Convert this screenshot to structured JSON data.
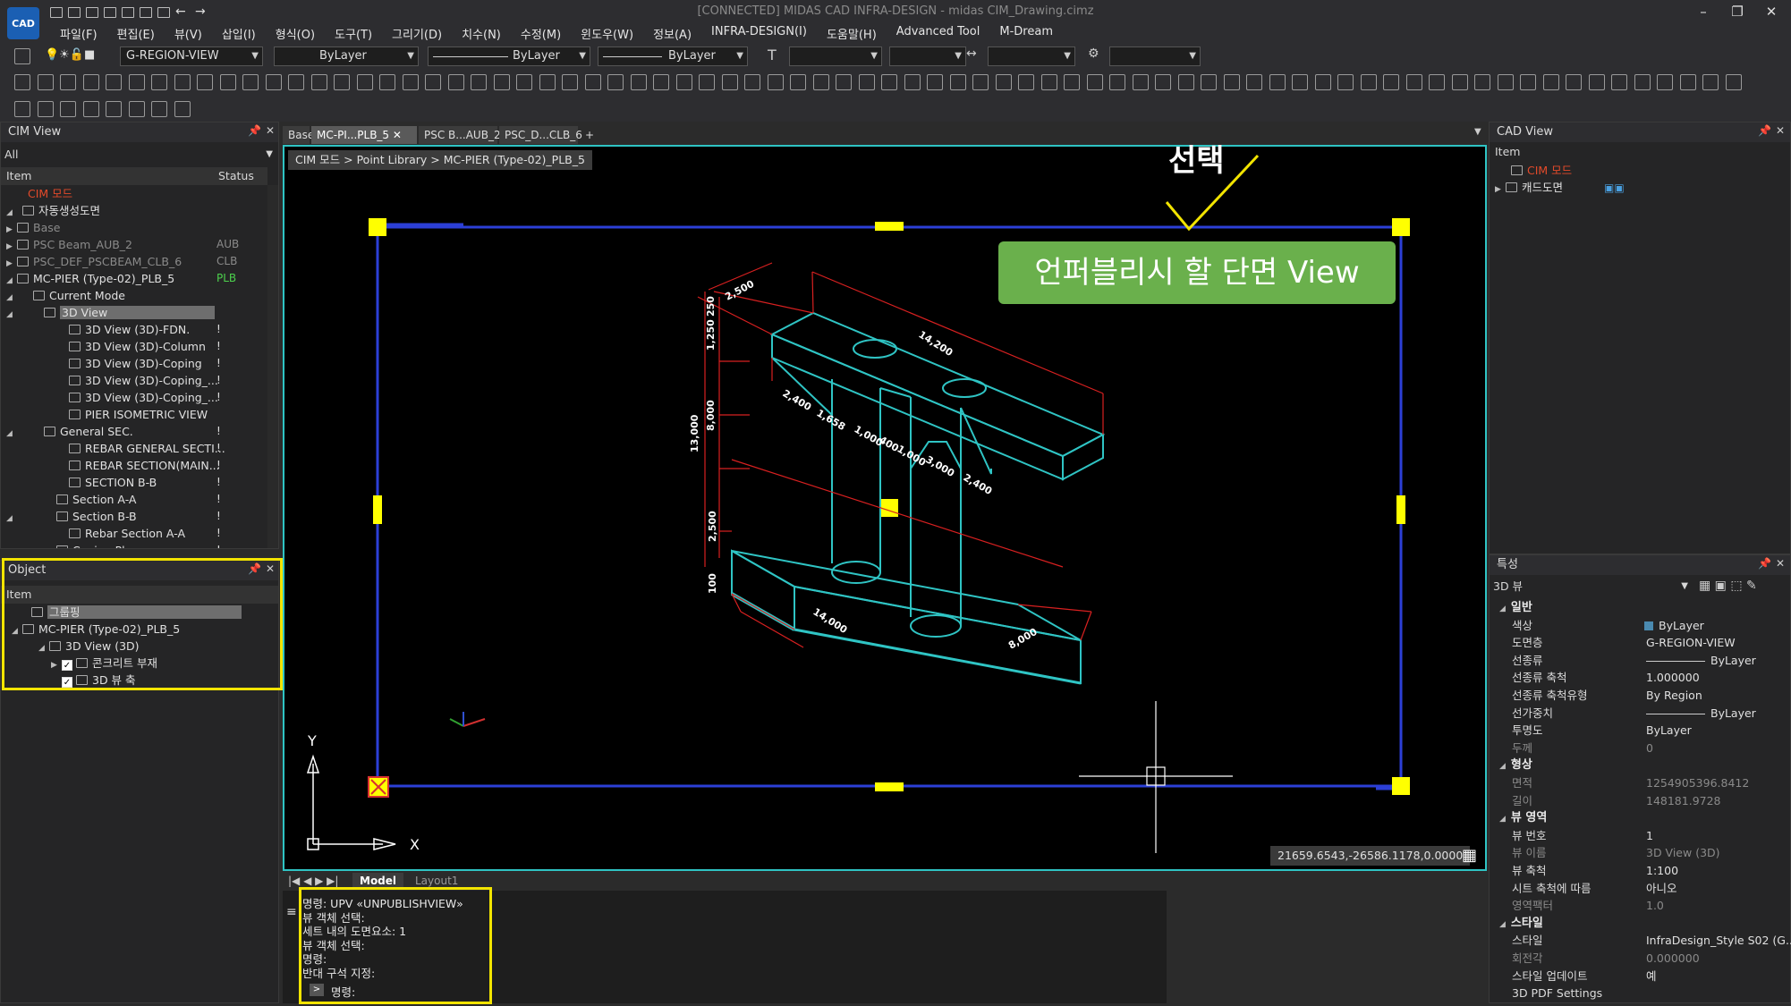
{
  "window": {
    "title": "[CONNECTED] MIDAS CAD INFRA-DESIGN - midas CIM_Drawing.cimz",
    "logo_text": "CAD",
    "buttons": [
      "–",
      "❐",
      "✕"
    ]
  },
  "menu": [
    "파일(F)",
    "편집(E)",
    "뷰(V)",
    "삽입(I)",
    "형식(O)",
    "도구(T)",
    "그리기(D)",
    "치수(N)",
    "수정(M)",
    "윈도우(W)",
    "정보(A)",
    "INFRA-DESIGN(I)",
    "도움말(H)",
    "Advanced Tool",
    "M-Dream"
  ],
  "toolbar": {
    "layer": "G-REGION-VIEW",
    "color": "ByLayer",
    "linetype": "ByLayer",
    "lineweight": "ByLayer",
    "color_swatch": "#4a8ab0"
  },
  "cim_view": {
    "title": "CIM View",
    "filter": "All",
    "col_item": "Item",
    "col_status": "Status",
    "rows": [
      {
        "label": "CIM 모드",
        "status": "",
        "color": "#e34a2a"
      },
      {
        "label": "자동생성도면",
        "status": "",
        "color": "#e0e0e0"
      },
      {
        "label": "Base",
        "status": "",
        "color": "#8a8a8a"
      },
      {
        "label": "PSC Beam_AUB_2",
        "status": "AUB",
        "color": "#8a8a8a"
      },
      {
        "label": "PSC_DEF_PSCBEAM_CLB_6",
        "status": "CLB",
        "color": "#8a8a8a"
      },
      {
        "label": "MC-PIER (Type-02)_PLB_5",
        "status": "PLB",
        "color": "#e0e0e0"
      },
      {
        "label": "Current Mode",
        "status": "",
        "color": "#e0e0e0"
      },
      {
        "label": "3D View",
        "status": "",
        "color": "#e0e0e0"
      },
      {
        "label": "3D View (3D)-FDN.",
        "status": "!",
        "color": "#e0e0e0"
      },
      {
        "label": "3D View (3D)-Column",
        "status": "!",
        "color": "#e0e0e0"
      },
      {
        "label": "3D View (3D)-Coping",
        "status": "!",
        "color": "#e0e0e0"
      },
      {
        "label": "3D View (3D)-Coping_...",
        "status": "!",
        "color": "#e0e0e0"
      },
      {
        "label": "3D View (3D)-Coping_...",
        "status": "!",
        "color": "#e0e0e0"
      },
      {
        "label": "PIER ISOMETRIC VIEW",
        "status": "",
        "color": "#e0e0e0"
      },
      {
        "label": "General SEC.",
        "status": "!",
        "color": "#e0e0e0"
      },
      {
        "label": "REBAR GENERAL SECTI...",
        "status": "!",
        "color": "#e0e0e0"
      },
      {
        "label": "REBAR SECTION(MAIN...",
        "status": "!",
        "color": "#e0e0e0"
      },
      {
        "label": "SECTION B-B",
        "status": "!",
        "color": "#e0e0e0"
      },
      {
        "label": "Section A-A",
        "status": "!",
        "color": "#e0e0e0"
      },
      {
        "label": "Section B-B",
        "status": "!",
        "color": "#e0e0e0"
      },
      {
        "label": "Rebar Section A-A",
        "status": "!",
        "color": "#e0e0e0"
      },
      {
        "label": "Coping Plan",
        "status": "!",
        "color": "#e0e0e0"
      }
    ]
  },
  "object_panel": {
    "title": "Object",
    "col_item": "Item",
    "rows": [
      "그룹핑",
      "MC-PIER (Type-02)_PLB_5",
      "3D View (3D)",
      "콘크리트 부재",
      "3D 뷰 축"
    ]
  },
  "tabs": [
    "Base",
    "MC-PI...PLB_5",
    "PSC B...AUB_2",
    "PSC_D...CLB_6"
  ],
  "tab_add": "+",
  "breadcrumb": "CIM 모드 > Point Library > MC-PIER (Type-02)_PLB_5",
  "annotation": {
    "label": "선택",
    "callout": "언퍼블리시 할 단면 View",
    "callout_color": "#6ab04c"
  },
  "drawing": {
    "dims": [
      "2,500",
      "14,200",
      "1,250",
      "250",
      "13,000",
      "8,000",
      "2,400",
      "1,658",
      "1,000",
      "400",
      "1,000",
      "3,000",
      "2,400",
      "2,500",
      "100",
      "14,000",
      "8,000"
    ]
  },
  "ucs": {
    "x": "X",
    "y": "Y"
  },
  "coords": "21659.6543,-26586.1178,0.0000",
  "layout_tabs": [
    "Model",
    "Layout1"
  ],
  "command": {
    "lines": [
      "명령: UPV «UNPUBLISHVIEW»",
      "뷰 객체 선택:",
      "세트 내의 도면요소: 1",
      "뷰 객체 선택:",
      "명령:",
      "반대 구석 지정:"
    ],
    "prompt": "명령:"
  },
  "cad_view": {
    "title": "CAD View",
    "col_item": "Item",
    "rows": [
      "CIM 모드",
      "캐드도면"
    ]
  },
  "properties": {
    "title": "특성",
    "selected": "3D 뷰",
    "groups": [
      {
        "name": "일반",
        "rows": [
          [
            "색상",
            "ByLayer"
          ],
          [
            "도면층",
            "G-REGION-VIEW"
          ],
          [
            "선종류",
            "ByLayer"
          ],
          [
            "선종류 축척",
            "1.000000"
          ],
          [
            "선종류 축척유형",
            "By Region"
          ],
          [
            "선가중치",
            "ByLayer"
          ],
          [
            "투명도",
            "ByLayer"
          ],
          [
            "두께",
            "0"
          ]
        ]
      },
      {
        "name": "형상",
        "rows": [
          [
            "면적",
            "1254905396.8412"
          ],
          [
            "길이",
            "148181.9728"
          ]
        ]
      },
      {
        "name": "뷰 영역",
        "rows": [
          [
            "뷰 번호",
            "1"
          ],
          [
            "뷰 이름",
            "3D View (3D)"
          ],
          [
            "뷰 축척",
            "1:100"
          ],
          [
            "시트 축척에 따름",
            "아니오"
          ],
          [
            "영역팩터",
            "1.0"
          ]
        ]
      },
      {
        "name": "스타일",
        "rows": [
          [
            "스타일",
            "InfraDesign_Style S02 (G..."
          ],
          [
            "회전각",
            "0.000000"
          ],
          [
            "스타일 업데이트",
            "예"
          ],
          [
            "3D PDF Settings",
            ""
          ]
        ]
      }
    ]
  }
}
